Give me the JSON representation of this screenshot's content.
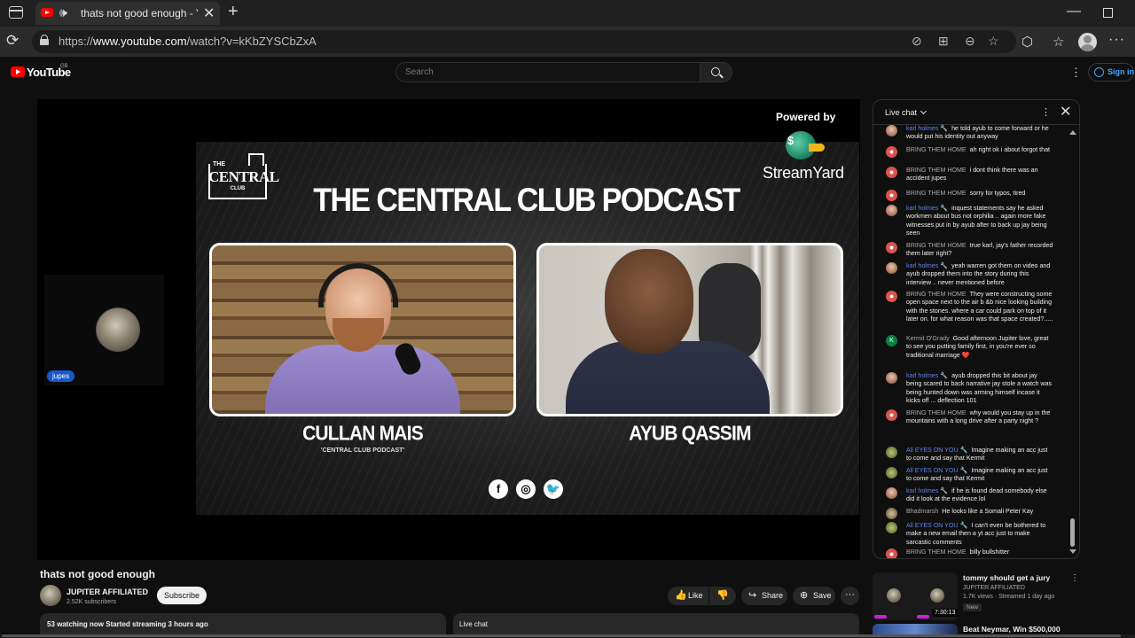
{
  "browser": {
    "tab_title": "thats not good enough - YouTube",
    "url_scheme": "https://",
    "url_host": "www.youtube.com",
    "url_path": "/watch?v=kKbZYSCbZxA"
  },
  "youtube": {
    "logo_text": "YouTube",
    "country_code": "GB",
    "search_placeholder": "Search",
    "sign_in_label": "Sign in"
  },
  "player": {
    "powered_by": "Powered by",
    "streamyard_text": "StreamYard",
    "logo_the": "THE",
    "logo_main": "CENTRAL",
    "logo_sub": "CLUB",
    "podcast_title": "THE CENTRAL CLUB PODCAST",
    "host_left_name": "CULLAN MAIS",
    "host_left_sub": "'CENTRAL CLUB PODCAST'",
    "host_right_name": "AYUB QASSIM",
    "participant_tag": "jupes",
    "social_icons": [
      "facebook-icon",
      "instagram-icon",
      "twitter-icon"
    ]
  },
  "video": {
    "title": "thats not good enough",
    "channel_name": "JUPITER AFFILIATED",
    "channel_subs": "2.52K subscribers",
    "subscribe_label": "Subscribe",
    "like_label": "Like",
    "share_label": "Share",
    "save_label": "Save",
    "description_summary": "53 watching now  Started streaming 3 hours ago",
    "live_chat_collapsed_label": "Live chat"
  },
  "chat": {
    "header_title": "Live chat",
    "messages": [
      {
        "author": "karl holmes 🔧",
        "author_color": "blue",
        "avatar": "karl",
        "text": "he told ayub to come forward or he would put his identity out anyway"
      },
      {
        "author": "BRING THEM HOME",
        "author_color": "grey",
        "avatar": "btb",
        "text": "ah right ok i about forgot that"
      },
      {
        "author": "BRING THEM HOME",
        "author_color": "grey",
        "avatar": "btb",
        "text": "i dont think there was an accident jupes"
      },
      {
        "author": "BRING THEM HOME",
        "author_color": "grey",
        "avatar": "btb",
        "text": "sorry for typos, tired"
      },
      {
        "author": "karl holmes 🔧",
        "author_color": "blue",
        "avatar": "karl",
        "text": "inquest statements say he asked workmen about bus not orphilia .. again more fake witnesses put in by ayub after to back up jay being seen"
      },
      {
        "author": "BRING THEM HOME",
        "author_color": "grey",
        "avatar": "btb",
        "text": "true karl, jay's father recorded them later right?"
      },
      {
        "author": "karl holmes 🔧",
        "author_color": "blue",
        "avatar": "karl",
        "text": "yeah warren got them on video and ayub dropped them into the story during this interview .. never mentioned before"
      },
      {
        "author": "BRING THEM HOME",
        "author_color": "grey",
        "avatar": "btb",
        "text": "They were constructing some open space next to the air b &b nice looking building with the stones. where a car could park on top of it later on. for what reason was that space created?....."
      },
      {
        "author": "Kermit O'Grady",
        "author_color": "grey",
        "avatar": "kermit",
        "text": "Good afternoon Jupiter love, great to see you putting family first, in you're ever so traditional marriage ❤️"
      },
      {
        "author": "karl holmes 🔧",
        "author_color": "blue",
        "avatar": "karl",
        "text": "ayub dropped this bit about jay being scared to back narrative jay stole a watch was being hunted down was arming himself incase it kicks off ... deflection 101"
      },
      {
        "author": "BRING THEM HOME",
        "author_color": "grey",
        "avatar": "btb",
        "text": "why would you stay up in the mountains with a long drive after a party night ?"
      },
      {
        "author": "All EYES ON YOU 🔧",
        "author_color": "blue",
        "avatar": "eyes",
        "text": "Imagine making an acc just to come and say that Kermit"
      },
      {
        "author": "All EYES ON YOU 🔧",
        "author_color": "blue",
        "avatar": "eyes",
        "text": "Imagine making an acc just to come and say that Kermit"
      },
      {
        "author": "karl holmes 🔧",
        "author_color": "blue",
        "avatar": "karl",
        "text": "if he is found dead somebody else did it look at the evidence lol"
      },
      {
        "author": "Bhadmarsh",
        "author_color": "grey",
        "avatar": "bhad",
        "text": "He looks like a Somali Peter Kay"
      },
      {
        "author": "All EYES ON YOU 🔧",
        "author_color": "blue",
        "avatar": "eyes",
        "text": "I can't even be bothered to make a new email then a yt acc just to make sarcastic comments"
      },
      {
        "author": "BRING THEM HOME",
        "author_color": "grey",
        "avatar": "btb",
        "text": "billy bullshitter"
      }
    ],
    "kermit_initial": "K"
  },
  "recommendations": [
    {
      "title": "tommy should get a jury",
      "channel": "JUPITER AFFILIATED",
      "meta": "1.7K views · Streamed 1 day ago",
      "badge": "New",
      "duration": "7:30:13"
    },
    {
      "title": "Beat Neymar, Win $500,000"
    }
  ]
}
